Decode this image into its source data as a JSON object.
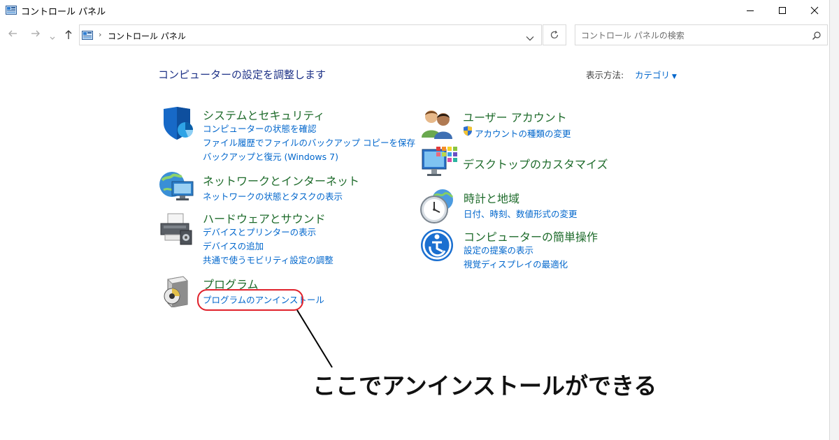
{
  "window": {
    "title": "コントロール パネル"
  },
  "address": {
    "crumb": "コントロール パネル",
    "separator": "›"
  },
  "search": {
    "placeholder": "コントロール パネルの検索"
  },
  "header": {
    "heading": "コンピューターの設定を調整します",
    "view_by_label": "表示方法:",
    "view_by_value": "カテゴリ"
  },
  "categories": [
    {
      "title": "システムとセキュリティ",
      "links": [
        "コンピューターの状態を確認",
        "ファイル履歴でファイルのバックアップ コピーを保存",
        "バックアップと復元 (Windows 7)"
      ],
      "icon": "shield-icon"
    },
    {
      "title": "ネットワークとインターネット",
      "links": [
        "ネットワークの状態とタスクの表示"
      ],
      "icon": "network-globe-icon"
    },
    {
      "title": "ハードウェアとサウンド",
      "links": [
        "デバイスとプリンターの表示",
        "デバイスの追加",
        "共通で使うモビリティ設定の調整"
      ],
      "icon": "printer-icon"
    },
    {
      "title": "プログラム",
      "links": [
        "プログラムのアンインストール"
      ],
      "icon": "program-box-icon"
    },
    {
      "title": "ユーザー アカウント",
      "links": [
        "アカウントの種類の変更"
      ],
      "icon": "users-icon"
    },
    {
      "title": "デスクトップのカスタマイズ",
      "links": [],
      "icon": "desktop-monitor-icon"
    },
    {
      "title": "時計と地域",
      "links": [
        "日付、時刻、数値形式の変更"
      ],
      "icon": "clock-globe-icon"
    },
    {
      "title": "コンピューターの簡単操作",
      "links": [
        "設定の提案の表示",
        "視覚ディスプレイの最適化"
      ],
      "icon": "ease-of-access-icon"
    }
  ],
  "annotation": {
    "text": "ここでアンインストールができる",
    "color": "#e0212b"
  },
  "colors": {
    "title_green": "#1e6b2b",
    "link_blue": "#0066cc",
    "heading_navy": "#1e3287"
  }
}
